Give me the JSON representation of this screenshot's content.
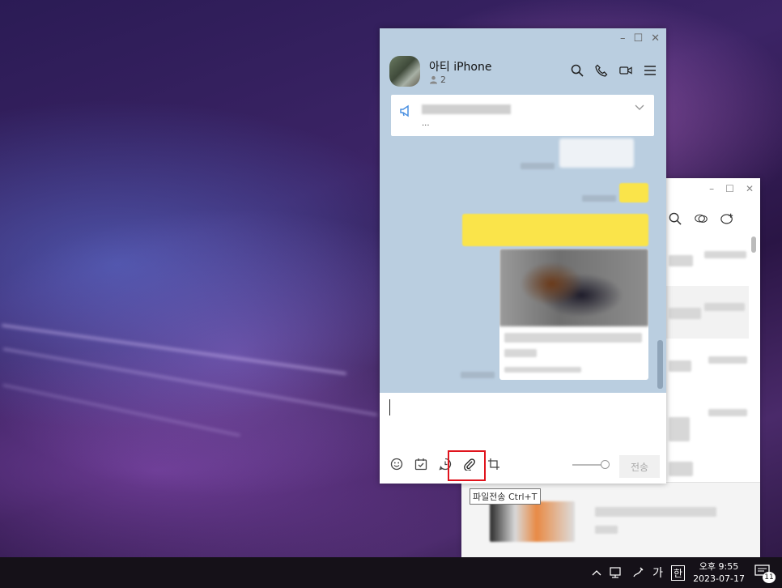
{
  "chat": {
    "title": "아티 iPhone",
    "member_count": "2",
    "notice_ellipsis": "...",
    "send_label": "전송",
    "tooltip": "파일전송 Ctrl+T"
  },
  "window_controls": {
    "minimize": "–",
    "maximize": "☐",
    "close": "✕"
  },
  "taskbar": {
    "ime_mode": "가",
    "ime_lang": "한",
    "time": "오후 9:55",
    "date": "2023-07-17",
    "notification_count": "11"
  },
  "colors": {
    "chat_bg": "#bacee0",
    "my_bubble": "#fae44a",
    "highlight_box": "#e0141d",
    "taskbar": "#151118"
  },
  "icons": [
    "search-icon",
    "phone-icon",
    "video-icon",
    "menu-icon",
    "megaphone-icon",
    "chevron-down-icon",
    "emoji-icon",
    "calendar-icon",
    "chat-clock-icon",
    "paperclip-icon",
    "crop-icon"
  ]
}
